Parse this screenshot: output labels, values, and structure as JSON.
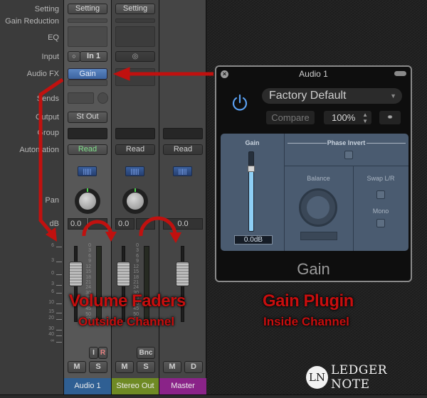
{
  "mixer": {
    "row_labels": {
      "setting": "Setting",
      "gain_reduction": "Gain Reduction",
      "eq": "EQ",
      "input": "Input",
      "audio_fx": "Audio FX",
      "sends": "Sends",
      "output": "Output",
      "group": "Group",
      "automation": "Automation",
      "pan": "Pan",
      "db": "dB"
    },
    "scale_marks": [
      "6",
      "3",
      "0",
      "3",
      "6",
      "10",
      "15",
      "20",
      "30",
      "40",
      "∞"
    ],
    "meter_marks": [
      "0",
      "3",
      "6",
      "9",
      "12",
      "15",
      "18",
      "21",
      "24",
      "30",
      "35",
      "40",
      "45",
      "50",
      "60"
    ],
    "channels": [
      {
        "name": "Audio 1",
        "color": "#2f5f93",
        "setting": "Setting",
        "input_icon": "mono-circle-icon",
        "input": "In 1",
        "audio_fx": "Gain",
        "output": "St Out",
        "automation": "Read",
        "automation_color": "#7fe08a",
        "pan_value": "0.0",
        "volume_db": 0.0,
        "buttons": [
          "I",
          "R",
          "M",
          "S"
        ]
      },
      {
        "name": "Stereo Out",
        "color": "#6f8a24",
        "setting": "Setting",
        "input_icon": "stereo-circles-icon",
        "automation": "Read",
        "pan_value": "0.0",
        "volume_db": 0.0,
        "buttons": [
          "Bnc",
          "M",
          "S"
        ]
      },
      {
        "name": "Master",
        "color": "#8a2388",
        "automation": "Read",
        "volume_value": "0.0",
        "volume_db": 0.0,
        "buttons": [
          "M",
          "D"
        ]
      }
    ]
  },
  "plugin": {
    "window_title": "Audio 1",
    "preset": "Factory Default",
    "compare_label": "Compare",
    "zoom": "100%",
    "link_icon": "link-icon",
    "gain_label": "Gain",
    "gain_value": "0.0dB",
    "gain_fader_fraction": 0.78,
    "phase_invert_label": "Phase Invert",
    "balance_label": "Balance",
    "swap_label": "Swap L/R",
    "mono_label": "Mono",
    "plugin_name": "Gain"
  },
  "annotations": {
    "faders_title": "Volume Faders",
    "faders_sub": "Outside Channel",
    "plugin_title": "Gain Plugin",
    "plugin_sub": "Inside Channel",
    "color": "#c80e0e"
  },
  "logo": {
    "mark": "LN",
    "text": "LEDGER NOTE"
  }
}
